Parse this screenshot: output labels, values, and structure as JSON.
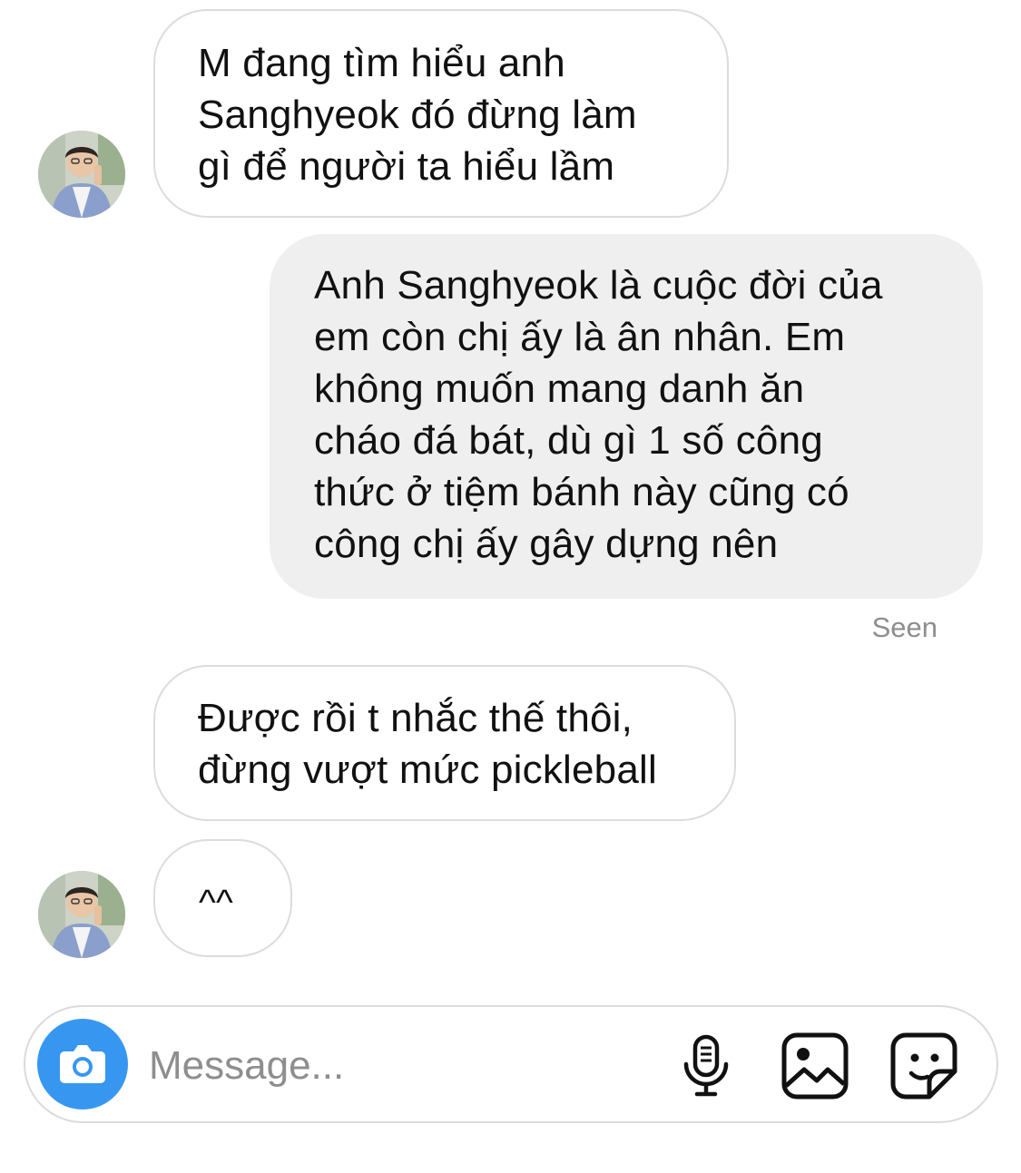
{
  "thread": {
    "messages": [
      {
        "from": "them",
        "text": "M đang tìm hiểu anh\nSanghyeok đó đừng làm\ngì để người ta hiểu lầm"
      },
      {
        "from": "me",
        "text": "Anh Sanghyeok là cuộc đời của\nem còn chị ấy là ân nhân. Em\nkhông muốn mang danh ăn\ncháo đá bát, dù gì 1 số công\nthức ở tiệm bánh này cũng có\ncông chị ấy gây dựng nên"
      },
      {
        "from": "them",
        "text": "Được rồi t nhắc thế thôi,\nđừng vượt mức pickleball"
      },
      {
        "from": "them",
        "text": "^^"
      }
    ],
    "seen_label": "Seen"
  },
  "composer": {
    "placeholder": "Message...",
    "value": "",
    "icons": [
      "camera-icon",
      "microphone-icon",
      "gallery-icon",
      "sticker-icon"
    ],
    "accent": "#3797f0"
  },
  "colors": {
    "outgoing_bubble": "#efefef",
    "incoming_border": "#dcdcdc",
    "muted_text": "#8e8e8e"
  }
}
